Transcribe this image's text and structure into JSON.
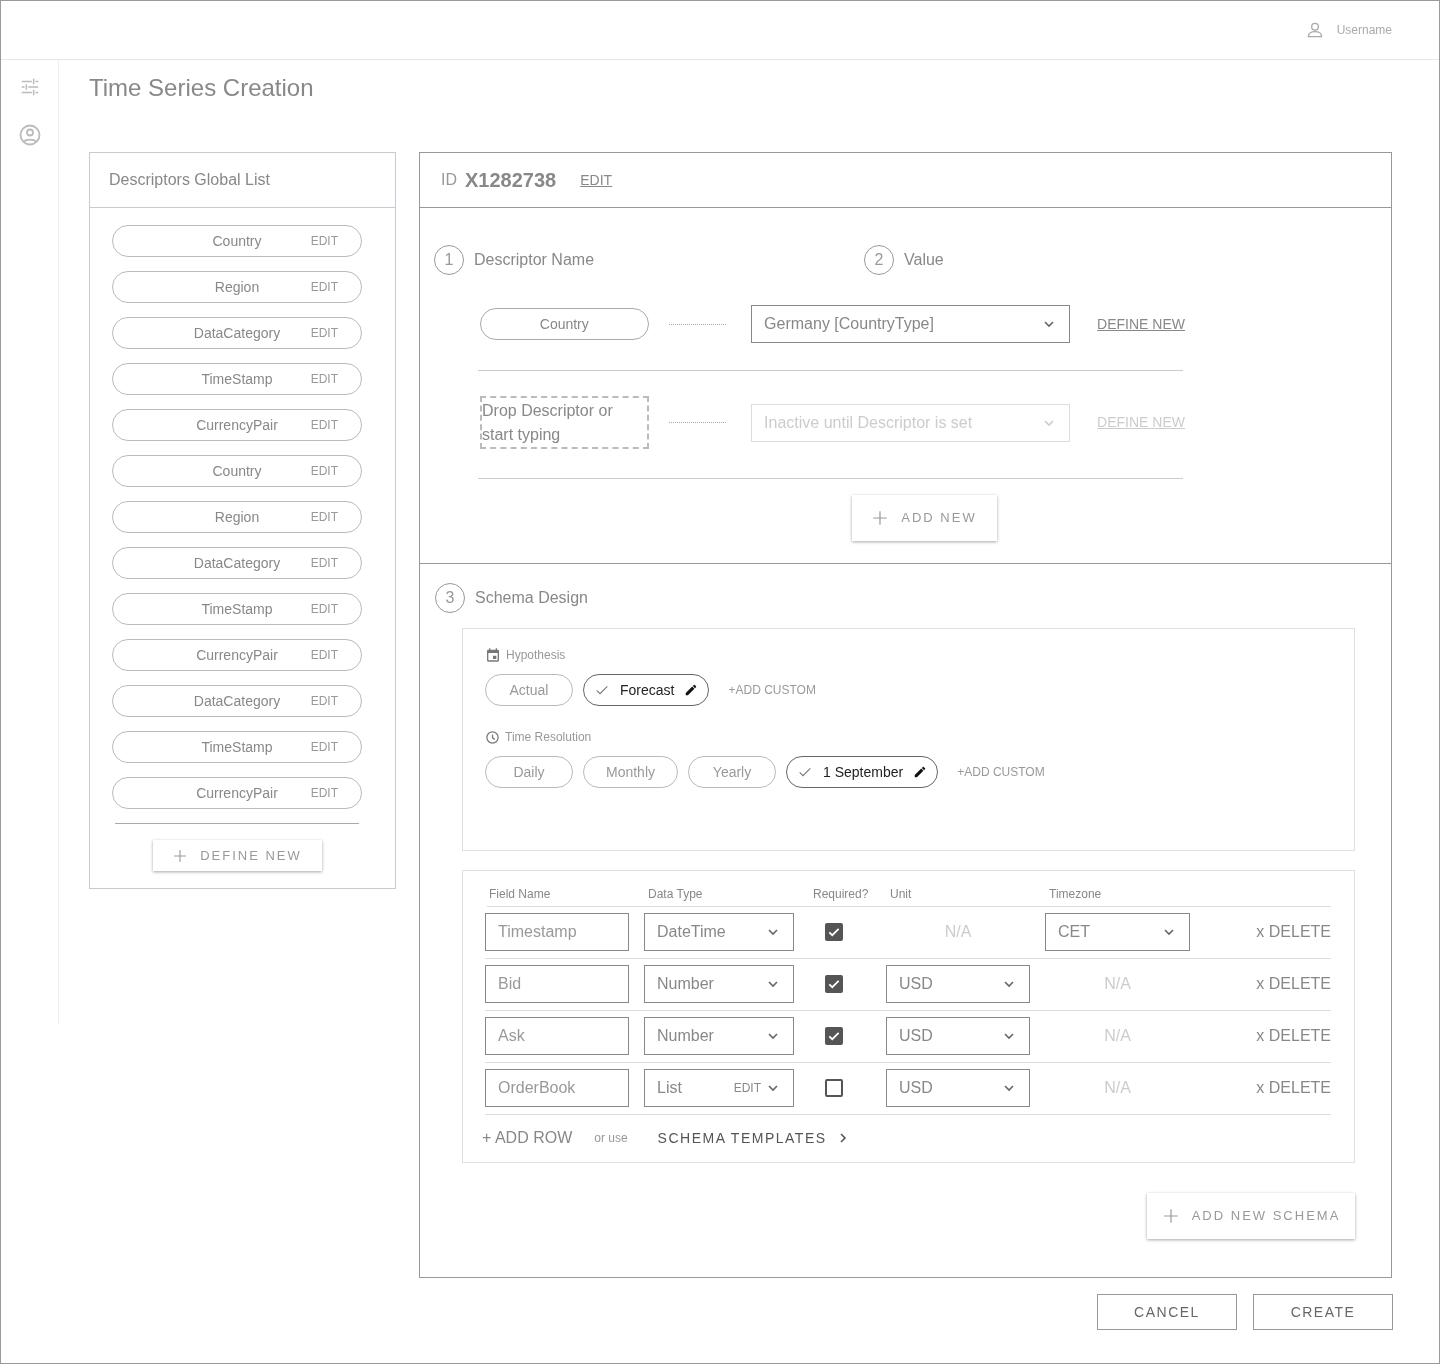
{
  "user": {
    "name": "Username"
  },
  "page_title": "Time Series Creation",
  "descriptors_list": {
    "title": "Descriptors Global List",
    "items": [
      {
        "label": "Country",
        "action": "EDIT"
      },
      {
        "label": "Region",
        "action": "EDIT"
      },
      {
        "label": "DataCategory",
        "action": "EDIT"
      },
      {
        "label": "TimeStamp",
        "action": "EDIT"
      },
      {
        "label": "CurrencyPair",
        "action": "EDIT"
      },
      {
        "label": "Country",
        "action": "EDIT"
      },
      {
        "label": "Region",
        "action": "EDIT"
      },
      {
        "label": "DataCategory",
        "action": "EDIT"
      },
      {
        "label": "TimeStamp",
        "action": "EDIT"
      },
      {
        "label": "CurrencyPair",
        "action": "EDIT"
      },
      {
        "label": "DataCategory",
        "action": "EDIT"
      },
      {
        "label": "TimeStamp",
        "action": "EDIT"
      },
      {
        "label": "CurrencyPair",
        "action": "EDIT"
      }
    ],
    "define_new": "DEFINE NEW"
  },
  "series": {
    "id_label": "ID",
    "id": "X1282738",
    "edit": "EDIT",
    "steps": [
      {
        "number": "1",
        "label": "Descriptor Name"
      },
      {
        "number": "2",
        "label": "Value"
      }
    ],
    "descriptor_rows": [
      {
        "kind": "set",
        "descriptor": "Country",
        "value": "Germany [CountryType]",
        "define_new": "DEFINE NEW",
        "disabled": false
      },
      {
        "kind": "drop",
        "descriptor_placeholder": "Drop Descriptor or start typing",
        "value_placeholder": "Inactive until Descriptor is set",
        "define_new": "DEFINE NEW",
        "disabled": true
      }
    ],
    "add_new": "ADD NEW",
    "schema": {
      "number": "3",
      "label": "Schema Design",
      "chip_groups": [
        {
          "kind": "calendar",
          "title": "Hypothesis",
          "chips": [
            {
              "label": "Actual",
              "selected": false
            },
            {
              "label": "Forecast",
              "selected": true
            }
          ],
          "add_custom": "+ADD CUSTOM"
        },
        {
          "kind": "clock",
          "title": "Time Resolution",
          "chips": [
            {
              "label": "Daily",
              "selected": false
            },
            {
              "label": "Monthly",
              "selected": false
            },
            {
              "label": "Yearly",
              "selected": false
            },
            {
              "label": "1 September",
              "selected": true
            }
          ],
          "add_custom": "+ADD CUSTOM"
        }
      ],
      "table": {
        "columns": [
          "Field Name",
          "Data Type",
          "Required?",
          "Unit",
          "Timezone"
        ],
        "rows": [
          {
            "field_name": "Timestamp",
            "data_type": "DateTime",
            "required": true,
            "unit": {
              "kind": "text",
              "value": "N/A"
            },
            "timezone": {
              "kind": "select",
              "value": "CET"
            },
            "delete": "x DELETE"
          },
          {
            "field_name": "Bid",
            "data_type": "Number",
            "required": true,
            "unit": {
              "kind": "select",
              "value": "USD"
            },
            "timezone": {
              "kind": "text",
              "value": "N/A"
            },
            "delete": "x DELETE"
          },
          {
            "field_name": "Ask",
            "data_type": "Number",
            "required": true,
            "unit": {
              "kind": "select",
              "value": "USD"
            },
            "timezone": {
              "kind": "text",
              "value": "N/A"
            },
            "delete": "x DELETE"
          },
          {
            "field_name": "OrderBook",
            "data_type": "List",
            "data_type_action": "EDIT",
            "required": false,
            "unit": {
              "kind": "select",
              "value": "USD"
            },
            "timezone": {
              "kind": "text",
              "value": "N/A"
            },
            "delete": "x DELETE"
          }
        ]
      },
      "add_row": "+ ADD ROW",
      "or_use": "or use",
      "templates": "SCHEMA TEMPLATES",
      "add_schema": "ADD NEW SCHEMA"
    }
  },
  "footer_buttons": [
    {
      "label": "CANCEL"
    },
    {
      "label": "CREATE"
    }
  ]
}
